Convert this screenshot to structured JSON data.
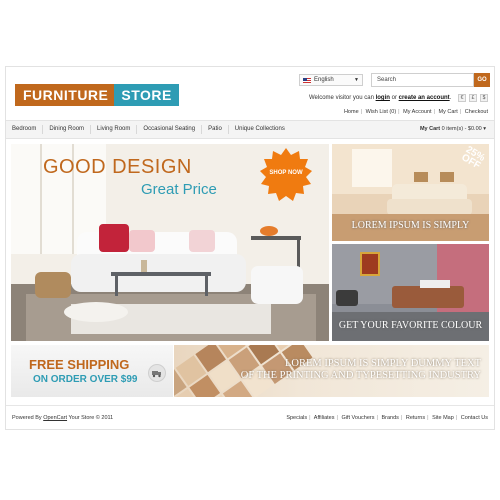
{
  "logo": {
    "part1": "FURNITURE",
    "part2": "STORE"
  },
  "language": {
    "label": "English",
    "flag_icon": "uk-flag-icon"
  },
  "search": {
    "placeholder": "Search",
    "button_label": "GO"
  },
  "welcome": {
    "prefix": "Welcome visitor you can",
    "login": "login",
    "or": "or",
    "create": "create an account",
    "suffix": "."
  },
  "currencies": [
    "€",
    "£",
    "$"
  ],
  "top_links": [
    "Home",
    "Wish List (0)",
    "My Account",
    "My Cart",
    "Checkout"
  ],
  "menu": [
    "Bedroom",
    "Dining Room",
    "Living Room",
    "Occasional Seating",
    "Patio",
    "Unique Collections"
  ],
  "cart": {
    "label": "My Cart",
    "summary": "0 item(s) - $0.00"
  },
  "hero": {
    "title": "GOOD DESIGN",
    "subtitle": "Great Price",
    "cta": "SHOP NOW"
  },
  "side_banner_1": {
    "caption": "LOREM IPSUM IS SIMPLY",
    "badge_line1": "25%",
    "badge_line2": "OFF"
  },
  "side_banner_2": {
    "caption": "GET YOUR FAVORITE COLOUR"
  },
  "shipping": {
    "line1": "FREE SHIPPING",
    "line2": "ON ORDER OVER $99"
  },
  "swatch_banner": {
    "line1": "LOREM IPSUM IS SIMPLY DUMMY TEXT",
    "line2": "OF THE PRINTING AND TYPESETTING INDUSTRY"
  },
  "footer": {
    "powered_prefix": "Powered By",
    "powered_link": "OpenCart",
    "powered_suffix": "Your Store © 2011",
    "links": [
      "Specials",
      "Affiliates",
      "Gift Vouchers",
      "Brands",
      "Returns",
      "Site Map",
      "Contact Us"
    ]
  },
  "colors": {
    "brand_orange": "#c0681d",
    "brand_teal": "#2e9cb4"
  }
}
